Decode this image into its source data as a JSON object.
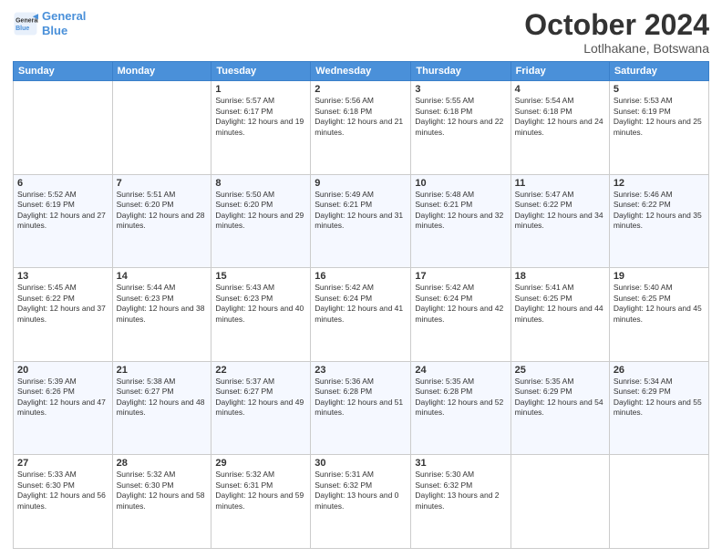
{
  "header": {
    "logo_line1": "General",
    "logo_line2": "Blue",
    "title": "October 2024",
    "subtitle": "Lotlhakane, Botswana"
  },
  "weekdays": [
    "Sunday",
    "Monday",
    "Tuesday",
    "Wednesday",
    "Thursday",
    "Friday",
    "Saturday"
  ],
  "weeks": [
    [
      {
        "day": "",
        "sunrise": "",
        "sunset": "",
        "daylight": ""
      },
      {
        "day": "",
        "sunrise": "",
        "sunset": "",
        "daylight": ""
      },
      {
        "day": "1",
        "sunrise": "Sunrise: 5:57 AM",
        "sunset": "Sunset: 6:17 PM",
        "daylight": "Daylight: 12 hours and 19 minutes."
      },
      {
        "day": "2",
        "sunrise": "Sunrise: 5:56 AM",
        "sunset": "Sunset: 6:18 PM",
        "daylight": "Daylight: 12 hours and 21 minutes."
      },
      {
        "day": "3",
        "sunrise": "Sunrise: 5:55 AM",
        "sunset": "Sunset: 6:18 PM",
        "daylight": "Daylight: 12 hours and 22 minutes."
      },
      {
        "day": "4",
        "sunrise": "Sunrise: 5:54 AM",
        "sunset": "Sunset: 6:18 PM",
        "daylight": "Daylight: 12 hours and 24 minutes."
      },
      {
        "day": "5",
        "sunrise": "Sunrise: 5:53 AM",
        "sunset": "Sunset: 6:19 PM",
        "daylight": "Daylight: 12 hours and 25 minutes."
      }
    ],
    [
      {
        "day": "6",
        "sunrise": "Sunrise: 5:52 AM",
        "sunset": "Sunset: 6:19 PM",
        "daylight": "Daylight: 12 hours and 27 minutes."
      },
      {
        "day": "7",
        "sunrise": "Sunrise: 5:51 AM",
        "sunset": "Sunset: 6:20 PM",
        "daylight": "Daylight: 12 hours and 28 minutes."
      },
      {
        "day": "8",
        "sunrise": "Sunrise: 5:50 AM",
        "sunset": "Sunset: 6:20 PM",
        "daylight": "Daylight: 12 hours and 29 minutes."
      },
      {
        "day": "9",
        "sunrise": "Sunrise: 5:49 AM",
        "sunset": "Sunset: 6:21 PM",
        "daylight": "Daylight: 12 hours and 31 minutes."
      },
      {
        "day": "10",
        "sunrise": "Sunrise: 5:48 AM",
        "sunset": "Sunset: 6:21 PM",
        "daylight": "Daylight: 12 hours and 32 minutes."
      },
      {
        "day": "11",
        "sunrise": "Sunrise: 5:47 AM",
        "sunset": "Sunset: 6:22 PM",
        "daylight": "Daylight: 12 hours and 34 minutes."
      },
      {
        "day": "12",
        "sunrise": "Sunrise: 5:46 AM",
        "sunset": "Sunset: 6:22 PM",
        "daylight": "Daylight: 12 hours and 35 minutes."
      }
    ],
    [
      {
        "day": "13",
        "sunrise": "Sunrise: 5:45 AM",
        "sunset": "Sunset: 6:22 PM",
        "daylight": "Daylight: 12 hours and 37 minutes."
      },
      {
        "day": "14",
        "sunrise": "Sunrise: 5:44 AM",
        "sunset": "Sunset: 6:23 PM",
        "daylight": "Daylight: 12 hours and 38 minutes."
      },
      {
        "day": "15",
        "sunrise": "Sunrise: 5:43 AM",
        "sunset": "Sunset: 6:23 PM",
        "daylight": "Daylight: 12 hours and 40 minutes."
      },
      {
        "day": "16",
        "sunrise": "Sunrise: 5:42 AM",
        "sunset": "Sunset: 6:24 PM",
        "daylight": "Daylight: 12 hours and 41 minutes."
      },
      {
        "day": "17",
        "sunrise": "Sunrise: 5:42 AM",
        "sunset": "Sunset: 6:24 PM",
        "daylight": "Daylight: 12 hours and 42 minutes."
      },
      {
        "day": "18",
        "sunrise": "Sunrise: 5:41 AM",
        "sunset": "Sunset: 6:25 PM",
        "daylight": "Daylight: 12 hours and 44 minutes."
      },
      {
        "day": "19",
        "sunrise": "Sunrise: 5:40 AM",
        "sunset": "Sunset: 6:25 PM",
        "daylight": "Daylight: 12 hours and 45 minutes."
      }
    ],
    [
      {
        "day": "20",
        "sunrise": "Sunrise: 5:39 AM",
        "sunset": "Sunset: 6:26 PM",
        "daylight": "Daylight: 12 hours and 47 minutes."
      },
      {
        "day": "21",
        "sunrise": "Sunrise: 5:38 AM",
        "sunset": "Sunset: 6:27 PM",
        "daylight": "Daylight: 12 hours and 48 minutes."
      },
      {
        "day": "22",
        "sunrise": "Sunrise: 5:37 AM",
        "sunset": "Sunset: 6:27 PM",
        "daylight": "Daylight: 12 hours and 49 minutes."
      },
      {
        "day": "23",
        "sunrise": "Sunrise: 5:36 AM",
        "sunset": "Sunset: 6:28 PM",
        "daylight": "Daylight: 12 hours and 51 minutes."
      },
      {
        "day": "24",
        "sunrise": "Sunrise: 5:35 AM",
        "sunset": "Sunset: 6:28 PM",
        "daylight": "Daylight: 12 hours and 52 minutes."
      },
      {
        "day": "25",
        "sunrise": "Sunrise: 5:35 AM",
        "sunset": "Sunset: 6:29 PM",
        "daylight": "Daylight: 12 hours and 54 minutes."
      },
      {
        "day": "26",
        "sunrise": "Sunrise: 5:34 AM",
        "sunset": "Sunset: 6:29 PM",
        "daylight": "Daylight: 12 hours and 55 minutes."
      }
    ],
    [
      {
        "day": "27",
        "sunrise": "Sunrise: 5:33 AM",
        "sunset": "Sunset: 6:30 PM",
        "daylight": "Daylight: 12 hours and 56 minutes."
      },
      {
        "day": "28",
        "sunrise": "Sunrise: 5:32 AM",
        "sunset": "Sunset: 6:30 PM",
        "daylight": "Daylight: 12 hours and 58 minutes."
      },
      {
        "day": "29",
        "sunrise": "Sunrise: 5:32 AM",
        "sunset": "Sunset: 6:31 PM",
        "daylight": "Daylight: 12 hours and 59 minutes."
      },
      {
        "day": "30",
        "sunrise": "Sunrise: 5:31 AM",
        "sunset": "Sunset: 6:32 PM",
        "daylight": "Daylight: 13 hours and 0 minutes."
      },
      {
        "day": "31",
        "sunrise": "Sunrise: 5:30 AM",
        "sunset": "Sunset: 6:32 PM",
        "daylight": "Daylight: 13 hours and 2 minutes."
      },
      {
        "day": "",
        "sunrise": "",
        "sunset": "",
        "daylight": ""
      },
      {
        "day": "",
        "sunrise": "",
        "sunset": "",
        "daylight": ""
      }
    ]
  ]
}
